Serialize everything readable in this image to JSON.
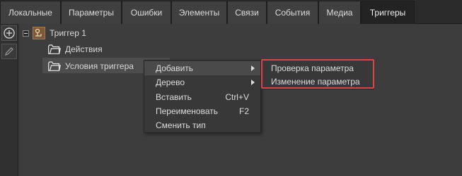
{
  "tabs": [
    {
      "label": "Локальные",
      "active": false
    },
    {
      "label": "Параметры",
      "active": false
    },
    {
      "label": "Ошибки",
      "active": false
    },
    {
      "label": "Элементы",
      "active": false
    },
    {
      "label": "Связи",
      "active": false
    },
    {
      "label": "События",
      "active": false
    },
    {
      "label": "Медиа",
      "active": false
    },
    {
      "label": "Триггеры",
      "active": true
    }
  ],
  "sidebar": {
    "buttons": [
      {
        "icon": "plus-circle-icon"
      },
      {
        "icon": "pencil-icon"
      }
    ]
  },
  "tree": {
    "root": {
      "label": "Триггер 1",
      "icon": "trigger-icon",
      "expanded": true
    },
    "children": [
      {
        "label": "Действия",
        "icon": "folder-icon"
      },
      {
        "label": "Условия триггера",
        "icon": "folder-icon",
        "selected": true
      }
    ]
  },
  "context_menu": {
    "items": [
      {
        "label": "Добавить",
        "shortcut": "",
        "has_submenu": true,
        "highlighted": true
      },
      {
        "label": "Дерево",
        "shortcut": "",
        "has_submenu": true,
        "highlighted": false
      },
      {
        "label": "Вставить",
        "shortcut": "Ctrl+V",
        "has_submenu": false,
        "highlighted": false
      },
      {
        "label": "Переименовать",
        "shortcut": "F2",
        "has_submenu": false,
        "highlighted": false
      },
      {
        "label": "Сменить тип",
        "shortcut": "",
        "has_submenu": false,
        "highlighted": false
      }
    ]
  },
  "submenu": {
    "items": [
      {
        "label": "Проверка параметра"
      },
      {
        "label": "Изменение параметра"
      }
    ],
    "highlight_color": "#e0424b"
  }
}
